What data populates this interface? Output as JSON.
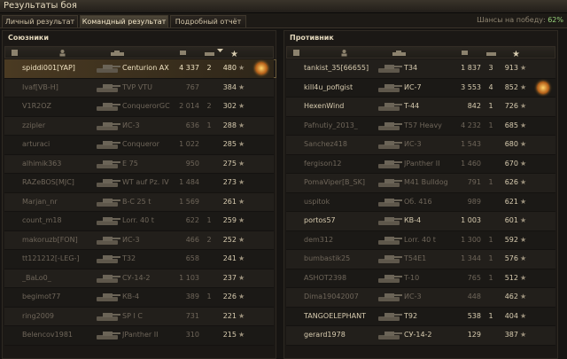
{
  "window": {
    "title": "Результаты боя"
  },
  "tabs": [
    {
      "label": "Личный результат",
      "active": false
    },
    {
      "label": "Командный результат",
      "active": true
    },
    {
      "label": "Подробный отчёт",
      "active": false
    }
  ],
  "chance": {
    "label": "Шансы на победу:",
    "value": "62%"
  },
  "allies": {
    "title": "Союзники",
    "rows": [
      {
        "name": "spiddi001[YAP]",
        "tank": "Centurion AX",
        "damage": "4 337",
        "kills": "2",
        "xp": "480",
        "alive": true,
        "me": true,
        "badge": true
      },
      {
        "name": "Ivaf[VB-H]",
        "tank": "TVP VTU",
        "damage": "767",
        "kills": "",
        "xp": "384",
        "alive": false
      },
      {
        "name": "V1R2OZ",
        "tank": "ConquerorGC",
        "damage": "2 014",
        "kills": "2",
        "xp": "302",
        "alive": false
      },
      {
        "name": "zzipler",
        "tank": "ИС-3",
        "damage": "636",
        "kills": "1",
        "xp": "288",
        "alive": false
      },
      {
        "name": "arturaci",
        "tank": "Conqueror",
        "damage": "1 022",
        "kills": "",
        "xp": "285",
        "alive": false
      },
      {
        "name": "alhimik363",
        "tank": "E 75",
        "damage": "950",
        "kills": "",
        "xp": "275",
        "alive": false
      },
      {
        "name": "RAZeBOS[MJC]",
        "tank": "WT auf Pz. IV",
        "damage": "1 484",
        "kills": "",
        "xp": "273",
        "alive": false
      },
      {
        "name": "Marjan_nr",
        "tank": "B-C 25 t",
        "damage": "1 569",
        "kills": "",
        "xp": "261",
        "alive": false
      },
      {
        "name": "count_m18",
        "tank": "Lorr. 40 t",
        "damage": "622",
        "kills": "1",
        "xp": "259",
        "alive": false
      },
      {
        "name": "makoruzb[FON]",
        "tank": "ИС-3",
        "damage": "466",
        "kills": "2",
        "xp": "252",
        "alive": false
      },
      {
        "name": "tt121212[-LEG-]",
        "tank": "T32",
        "damage": "658",
        "kills": "",
        "xp": "241",
        "alive": false
      },
      {
        "name": "_BaLo0_",
        "tank": "СУ-14-2",
        "damage": "1 103",
        "kills": "",
        "xp": "237",
        "alive": false
      },
      {
        "name": "begimot77",
        "tank": "КВ-4",
        "damage": "389",
        "kills": "1",
        "xp": "226",
        "alive": false
      },
      {
        "name": "ring2009",
        "tank": "SP I C",
        "damage": "731",
        "kills": "",
        "xp": "221",
        "alive": false
      },
      {
        "name": "Belencov1981",
        "tank": "JPanther II",
        "damage": "310",
        "kills": "",
        "xp": "215",
        "alive": false
      }
    ]
  },
  "enemies": {
    "title": "Противник",
    "rows": [
      {
        "name": "tankist_35[66655]",
        "tank": "T34",
        "damage": "1 837",
        "kills": "3",
        "xp": "913",
        "alive": true
      },
      {
        "name": "kill4u_pofigist",
        "tank": "ИС-7",
        "damage": "3 553",
        "kills": "4",
        "xp": "852",
        "alive": true,
        "badge": true
      },
      {
        "name": "HexenWind",
        "tank": "T-44",
        "damage": "842",
        "kills": "1",
        "xp": "726",
        "alive": true
      },
      {
        "name": "Pafnutiy_2013_",
        "tank": "T57 Heavy",
        "damage": "4 232",
        "kills": "1",
        "xp": "685",
        "alive": false
      },
      {
        "name": "Sanchez418",
        "tank": "ИС-3",
        "damage": "1 543",
        "kills": "",
        "xp": "680",
        "alive": false
      },
      {
        "name": "fergison12",
        "tank": "JPanther II",
        "damage": "1 460",
        "kills": "",
        "xp": "670",
        "alive": false
      },
      {
        "name": "PomaViper[B_SK]",
        "tank": "M41 Bulldog",
        "damage": "791",
        "kills": "1",
        "xp": "626",
        "alive": false
      },
      {
        "name": "uspitok",
        "tank": "Об. 416",
        "damage": "989",
        "kills": "",
        "xp": "621",
        "alive": false
      },
      {
        "name": "portos57",
        "tank": "КВ-4",
        "damage": "1 003",
        "kills": "",
        "xp": "601",
        "alive": true
      },
      {
        "name": "dem312",
        "tank": "Lorr. 40 t",
        "damage": "1 300",
        "kills": "1",
        "xp": "592",
        "alive": false
      },
      {
        "name": "bumbastik25",
        "tank": "T54E1",
        "damage": "1 344",
        "kills": "1",
        "xp": "576",
        "alive": false
      },
      {
        "name": "ASHOT2398",
        "tank": "T-10",
        "damage": "765",
        "kills": "1",
        "xp": "512",
        "alive": false
      },
      {
        "name": "Dima19042007",
        "tank": "ИС-3",
        "damage": "448",
        "kills": "",
        "xp": "462",
        "alive": false
      },
      {
        "name": "TANGOELEPHANT",
        "tank": "T92",
        "damage": "538",
        "kills": "1",
        "xp": "404",
        "alive": true
      },
      {
        "name": "gerard1978",
        "tank": "СУ-14-2",
        "damage": "129",
        "kills": "",
        "xp": "387",
        "alive": true
      }
    ]
  },
  "icons": {
    "star": "★",
    "header_icons": [
      "vehicle-type-icon",
      "player-icon",
      "tank-icon",
      "damage-icon",
      "kills-icon",
      "sort-icon",
      "xp-star-icon"
    ]
  }
}
